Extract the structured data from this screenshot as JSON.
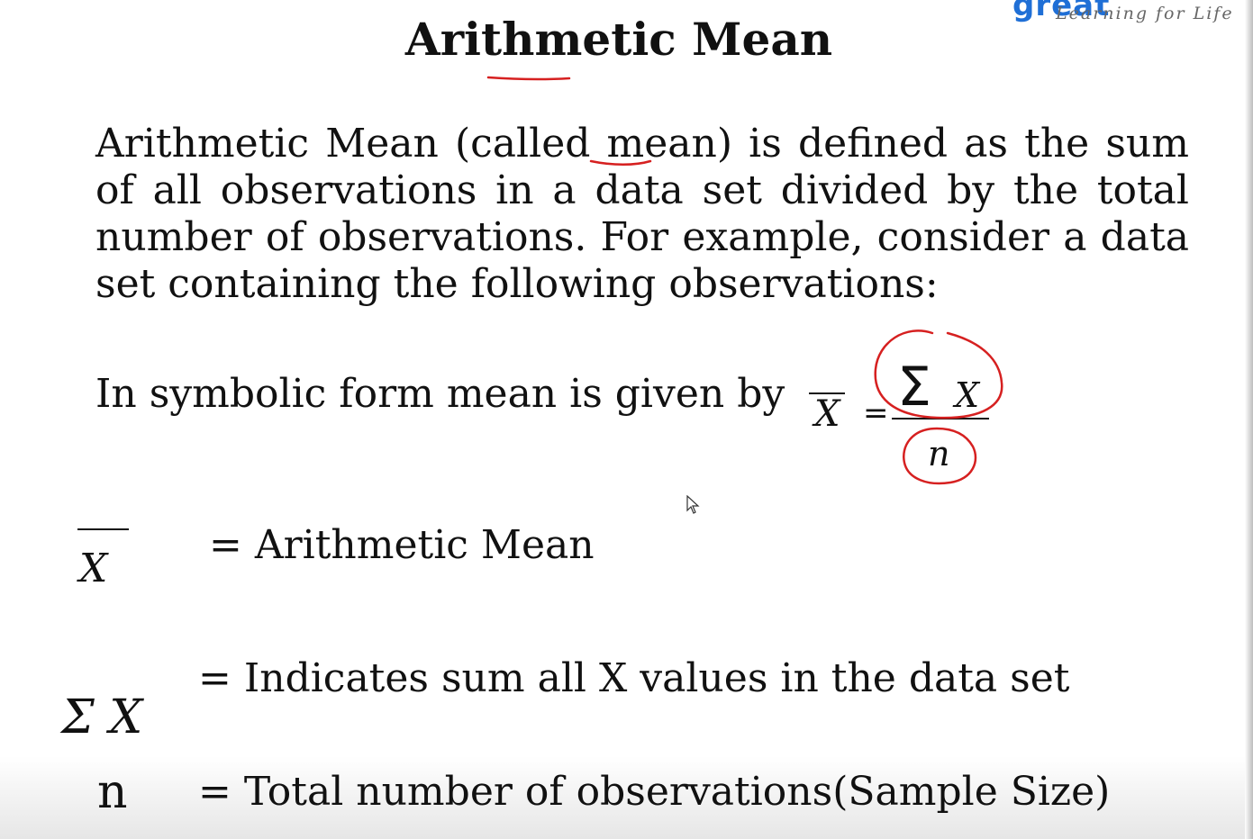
{
  "logo": {
    "wordmark": "great",
    "tagline": "Learning for Life",
    "brand_color": "#1f6fd6"
  },
  "slide": {
    "title": "Arithmetic Mean",
    "paragraph": "Arithmetic Mean (called mean) is defined as the sum of all observations in a data set divided by the total number of observations. For example, consider a data set containing the following observations:",
    "symbolic_text": "In symbolic form mean is given by",
    "formula": {
      "lhs": "X",
      "equals": "=",
      "sum_symbol": "Σ",
      "numerator_var": "X",
      "denominator": "n"
    },
    "definitions": [
      {
        "symbol": "X",
        "text": "= Arithmetic Mean"
      },
      {
        "symbol": "Σ X",
        "text": "= Indicates sum all X values in the data set"
      },
      {
        "symbol": "n",
        "text": "= Total number of observations(Sample Size)"
      }
    ]
  },
  "colors": {
    "text": "#111111",
    "annotation": "#d62020"
  },
  "icons": {
    "cursor": "mouse-pointer-icon"
  }
}
